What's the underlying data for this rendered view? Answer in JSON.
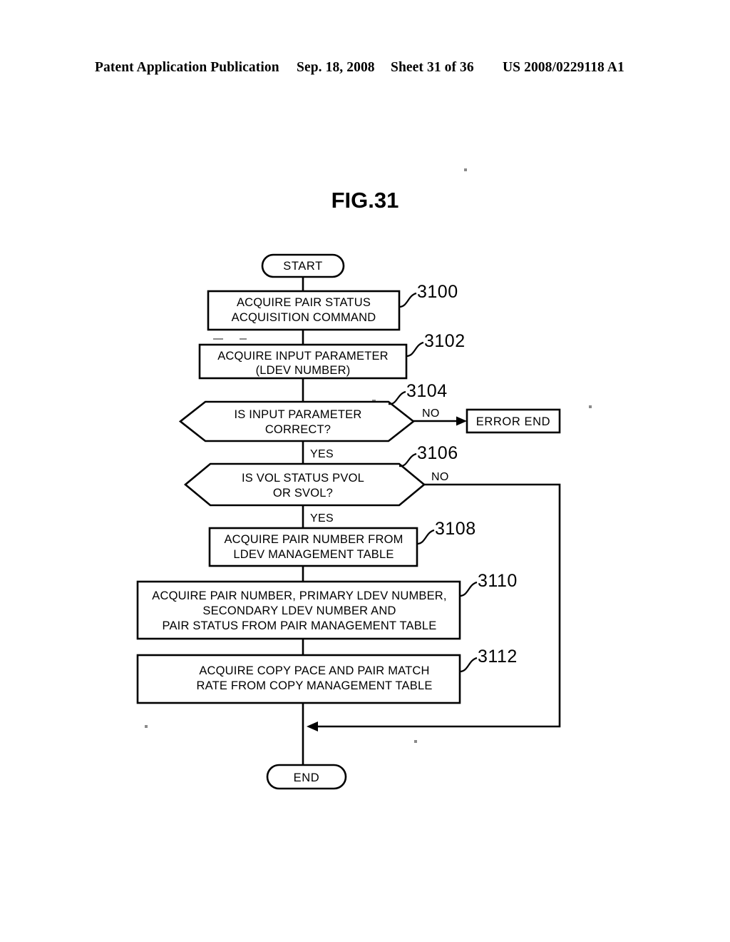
{
  "header": {
    "publication": "Patent Application Publication",
    "date": "Sep. 18, 2008",
    "sheet": "Sheet 31 of 36",
    "patent_number": "US 2008/0229118 A1"
  },
  "figure": {
    "title": "FIG.31"
  },
  "flowchart": {
    "terminals": {
      "start": "START",
      "end": "END",
      "error_end": "ERROR END"
    },
    "branch_labels": {
      "no_3104": "NO",
      "yes_3104": "YES",
      "no_3106": "NO",
      "yes_3106": "YES"
    },
    "steps": [
      {
        "ref": "3100",
        "type": "process",
        "lines": [
          "ACQUIRE PAIR STATUS",
          "ACQUISITION COMMAND"
        ]
      },
      {
        "ref": "3102",
        "type": "process",
        "lines": [
          "ACQUIRE INPUT PARAMETER",
          "(LDEV NUMBER)"
        ]
      },
      {
        "ref": "3104",
        "type": "decision",
        "lines": [
          "IS INPUT PARAMETER",
          "CORRECT?"
        ]
      },
      {
        "ref": "3106",
        "type": "decision",
        "lines": [
          "IS VOL STATUS PVOL",
          "OR SVOL?"
        ]
      },
      {
        "ref": "3108",
        "type": "process",
        "lines": [
          "ACQUIRE PAIR NUMBER FROM",
          "LDEV MANAGEMENT TABLE"
        ]
      },
      {
        "ref": "3110",
        "type": "process",
        "lines": [
          "ACQUIRE PAIR NUMBER, PRIMARY LDEV NUMBER,",
          "SECONDARY LDEV NUMBER AND",
          "PAIR STATUS FROM PAIR MANAGEMENT TABLE"
        ]
      },
      {
        "ref": "3112",
        "type": "process",
        "lines": [
          "ACQUIRE COPY PACE AND PAIR MATCH",
          "RATE FROM COPY MANAGEMENT TABLE"
        ]
      }
    ]
  },
  "colors": {
    "ink": "#000000",
    "page": "#ffffff"
  }
}
